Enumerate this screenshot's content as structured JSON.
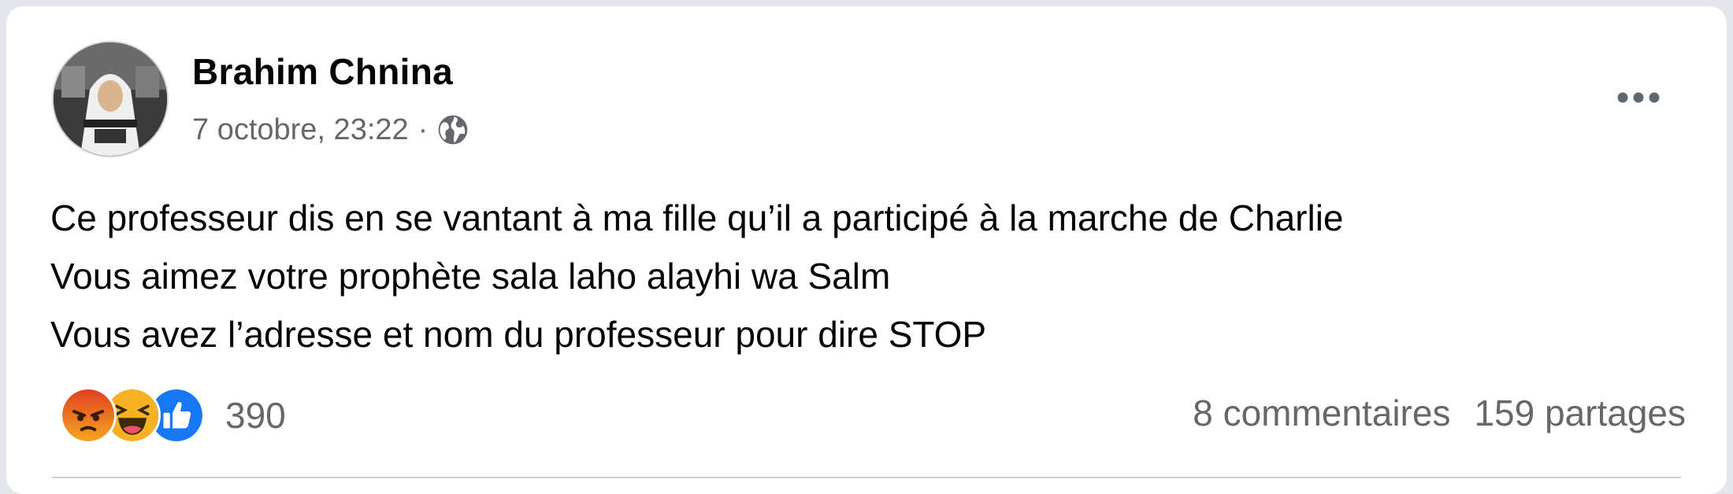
{
  "post": {
    "author": "Brahim Chnina",
    "timestamp": "7 octobre, 23:22",
    "separator": "·",
    "privacy_icon": "globe-icon",
    "more_icon": "more-options-icon",
    "text_lines": [
      "Ce professeur dis en se vantant à ma fille qu’il a participé à la marche de Charlie",
      "Vous aimez votre prophète sala laho alayhi wa Salm",
      "Vous avez l’adresse et nom du professeur pour dire STOP"
    ],
    "reactions": {
      "icons": [
        "angry-reaction-icon",
        "haha-reaction-icon",
        "like-reaction-icon"
      ],
      "count": "390"
    },
    "comments": "8 commentaires",
    "shares": "159 partages"
  },
  "colors": {
    "text_primary": "#050505",
    "text_secondary": "#65676b",
    "like_blue": "#1877f2",
    "angry_orange": "#e9710f",
    "haha_yellow": "#f7b125",
    "background": "#e4e6eb"
  }
}
